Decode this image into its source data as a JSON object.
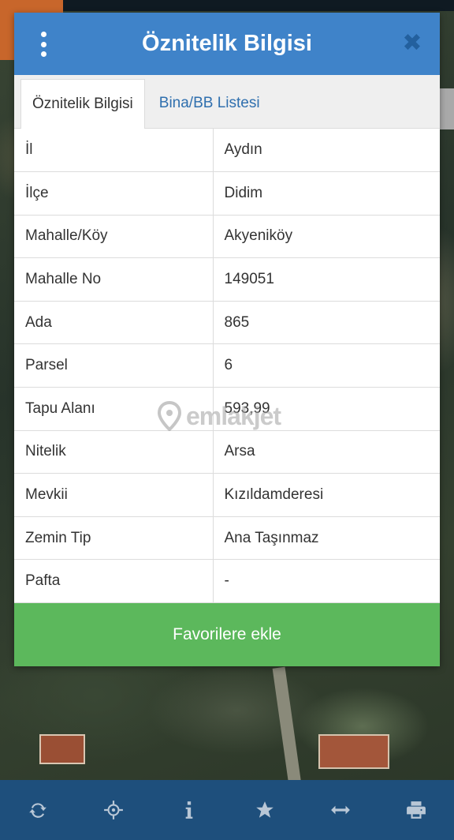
{
  "modal": {
    "title": "Öznitelik Bilgisi",
    "close_label": "✖",
    "tabs": [
      {
        "label": "Öznitelik Bilgisi",
        "active": true
      },
      {
        "label": "Bina/BB Listesi",
        "active": false
      }
    ],
    "rows": [
      {
        "key": "İl",
        "value": "Aydın"
      },
      {
        "key": "İlçe",
        "value": "Didim"
      },
      {
        "key": "Mahalle/Köy",
        "value": "Akyeniköy"
      },
      {
        "key": "Mahalle No",
        "value": "149051"
      },
      {
        "key": "Ada",
        "value": "865"
      },
      {
        "key": "Parsel",
        "value": "6"
      },
      {
        "key": "Tapu Alanı",
        "value": "593,99"
      },
      {
        "key": "Nitelik",
        "value": "Arsa"
      },
      {
        "key": "Mevkii",
        "value": "Kızıldamderesi"
      },
      {
        "key": "Zemin Tip",
        "value": "Ana Taşınmaz"
      },
      {
        "key": "Pafta",
        "value": "-"
      }
    ],
    "favorite_button": "Favorilere ekle"
  },
  "watermark": "emlakjet",
  "toolbar": {
    "icons": [
      "refresh-icon",
      "locate-icon",
      "info-icon",
      "star-icon",
      "measure-icon",
      "print-icon"
    ]
  },
  "colors": {
    "header": "#3f83c9",
    "favorite": "#5cb85c",
    "toolbar": "#1e4f7c",
    "tab_link": "#2f6fae"
  }
}
